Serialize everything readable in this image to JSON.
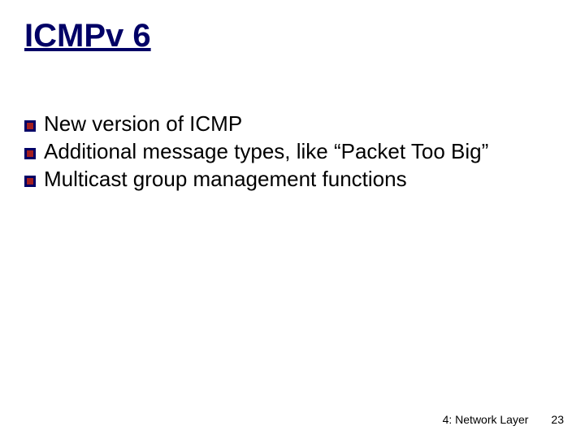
{
  "title": "ICMPv 6",
  "bullets": [
    "New version of ICMP",
    "Additional message types, like “Packet Too Big”",
    "Multicast group management functions"
  ],
  "footer": {
    "section": "4: Network Layer",
    "page": "23"
  }
}
